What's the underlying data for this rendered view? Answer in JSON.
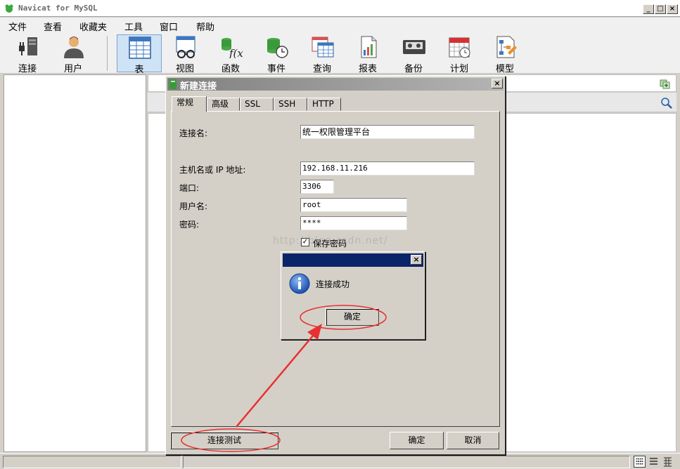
{
  "window": {
    "title": "Navicat for MySQL"
  },
  "menu": [
    "文件",
    "查看",
    "收藏夹",
    "工具",
    "窗口",
    "帮助"
  ],
  "toolbar": {
    "items": [
      {
        "label": "连接",
        "icon": "plug-connection-icon"
      },
      {
        "label": "用户",
        "icon": "user-icon"
      },
      {
        "label": "表",
        "icon": "table-icon",
        "active": true
      },
      {
        "label": "视图",
        "icon": "view-glasses-icon"
      },
      {
        "label": "函数",
        "icon": "function-icon"
      },
      {
        "label": "事件",
        "icon": "event-clock-icon"
      },
      {
        "label": "查询",
        "icon": "query-icon"
      },
      {
        "label": "报表",
        "icon": "report-icon"
      },
      {
        "label": "备份",
        "icon": "backup-tape-icon"
      },
      {
        "label": "计划",
        "icon": "calendar-schedule-icon"
      },
      {
        "label": "模型",
        "icon": "model-diagram-icon"
      }
    ]
  },
  "dialog": {
    "title": "新建连接",
    "tabs": [
      "常规",
      "高级",
      "SSL",
      "SSH",
      "HTTP"
    ],
    "active_tab": "常规",
    "fields": {
      "conn_name_label": "连接名:",
      "conn_name_value": "统一权限管理平台",
      "host_label": "主机名或 IP 地址:",
      "host_value": "192.168.11.216",
      "port_label": "端口:",
      "port_value": "3306",
      "user_label": "用户名:",
      "user_value": "root",
      "password_label": "密码:",
      "password_value": "****",
      "save_password_label": "保存密码",
      "save_password_checked": true
    },
    "buttons": {
      "test": "连接测试",
      "ok": "确定",
      "cancel": "取消"
    }
  },
  "message_box": {
    "text": "连接成功",
    "ok": "确定",
    "icon": "info-icon"
  },
  "watermark": "http://blog.csdn.net/",
  "annotation_color": "#e83030"
}
